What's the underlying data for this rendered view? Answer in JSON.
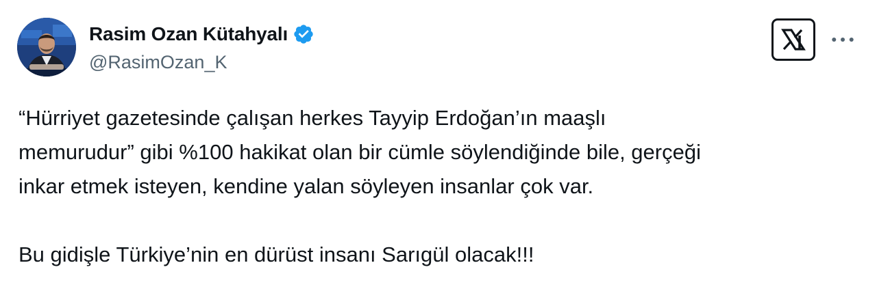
{
  "author": {
    "display_name": "Rasim Ozan Kütahyalı",
    "handle": "@RasimOzan_K",
    "verified": true,
    "verified_icon": "verified-badge-icon",
    "avatar_icon": "user-avatar"
  },
  "header_actions": {
    "x_logo_icon": "x-logo-icon",
    "more_icon": "more-horizontal-icon"
  },
  "tweet": {
    "paragraph_1": "“Hürriyet gazetesinde çalışan herkes Tayyip Erdoğan’ın maaşlı\nmemurudur” gibi %100 hakikat olan bir cümle söylendiğinde bile, gerçeği\ninkar etmek isteyen, kendine yalan söyleyen insanlar çok var.",
    "paragraph_2": "Bu gidişle Türkiye’nin en dürüst insanı Sarıgül olacak!!!"
  },
  "colors": {
    "text_primary": "#0f1419",
    "text_secondary": "#536471",
    "verified_blue": "#1d9bf0",
    "background": "#ffffff"
  }
}
